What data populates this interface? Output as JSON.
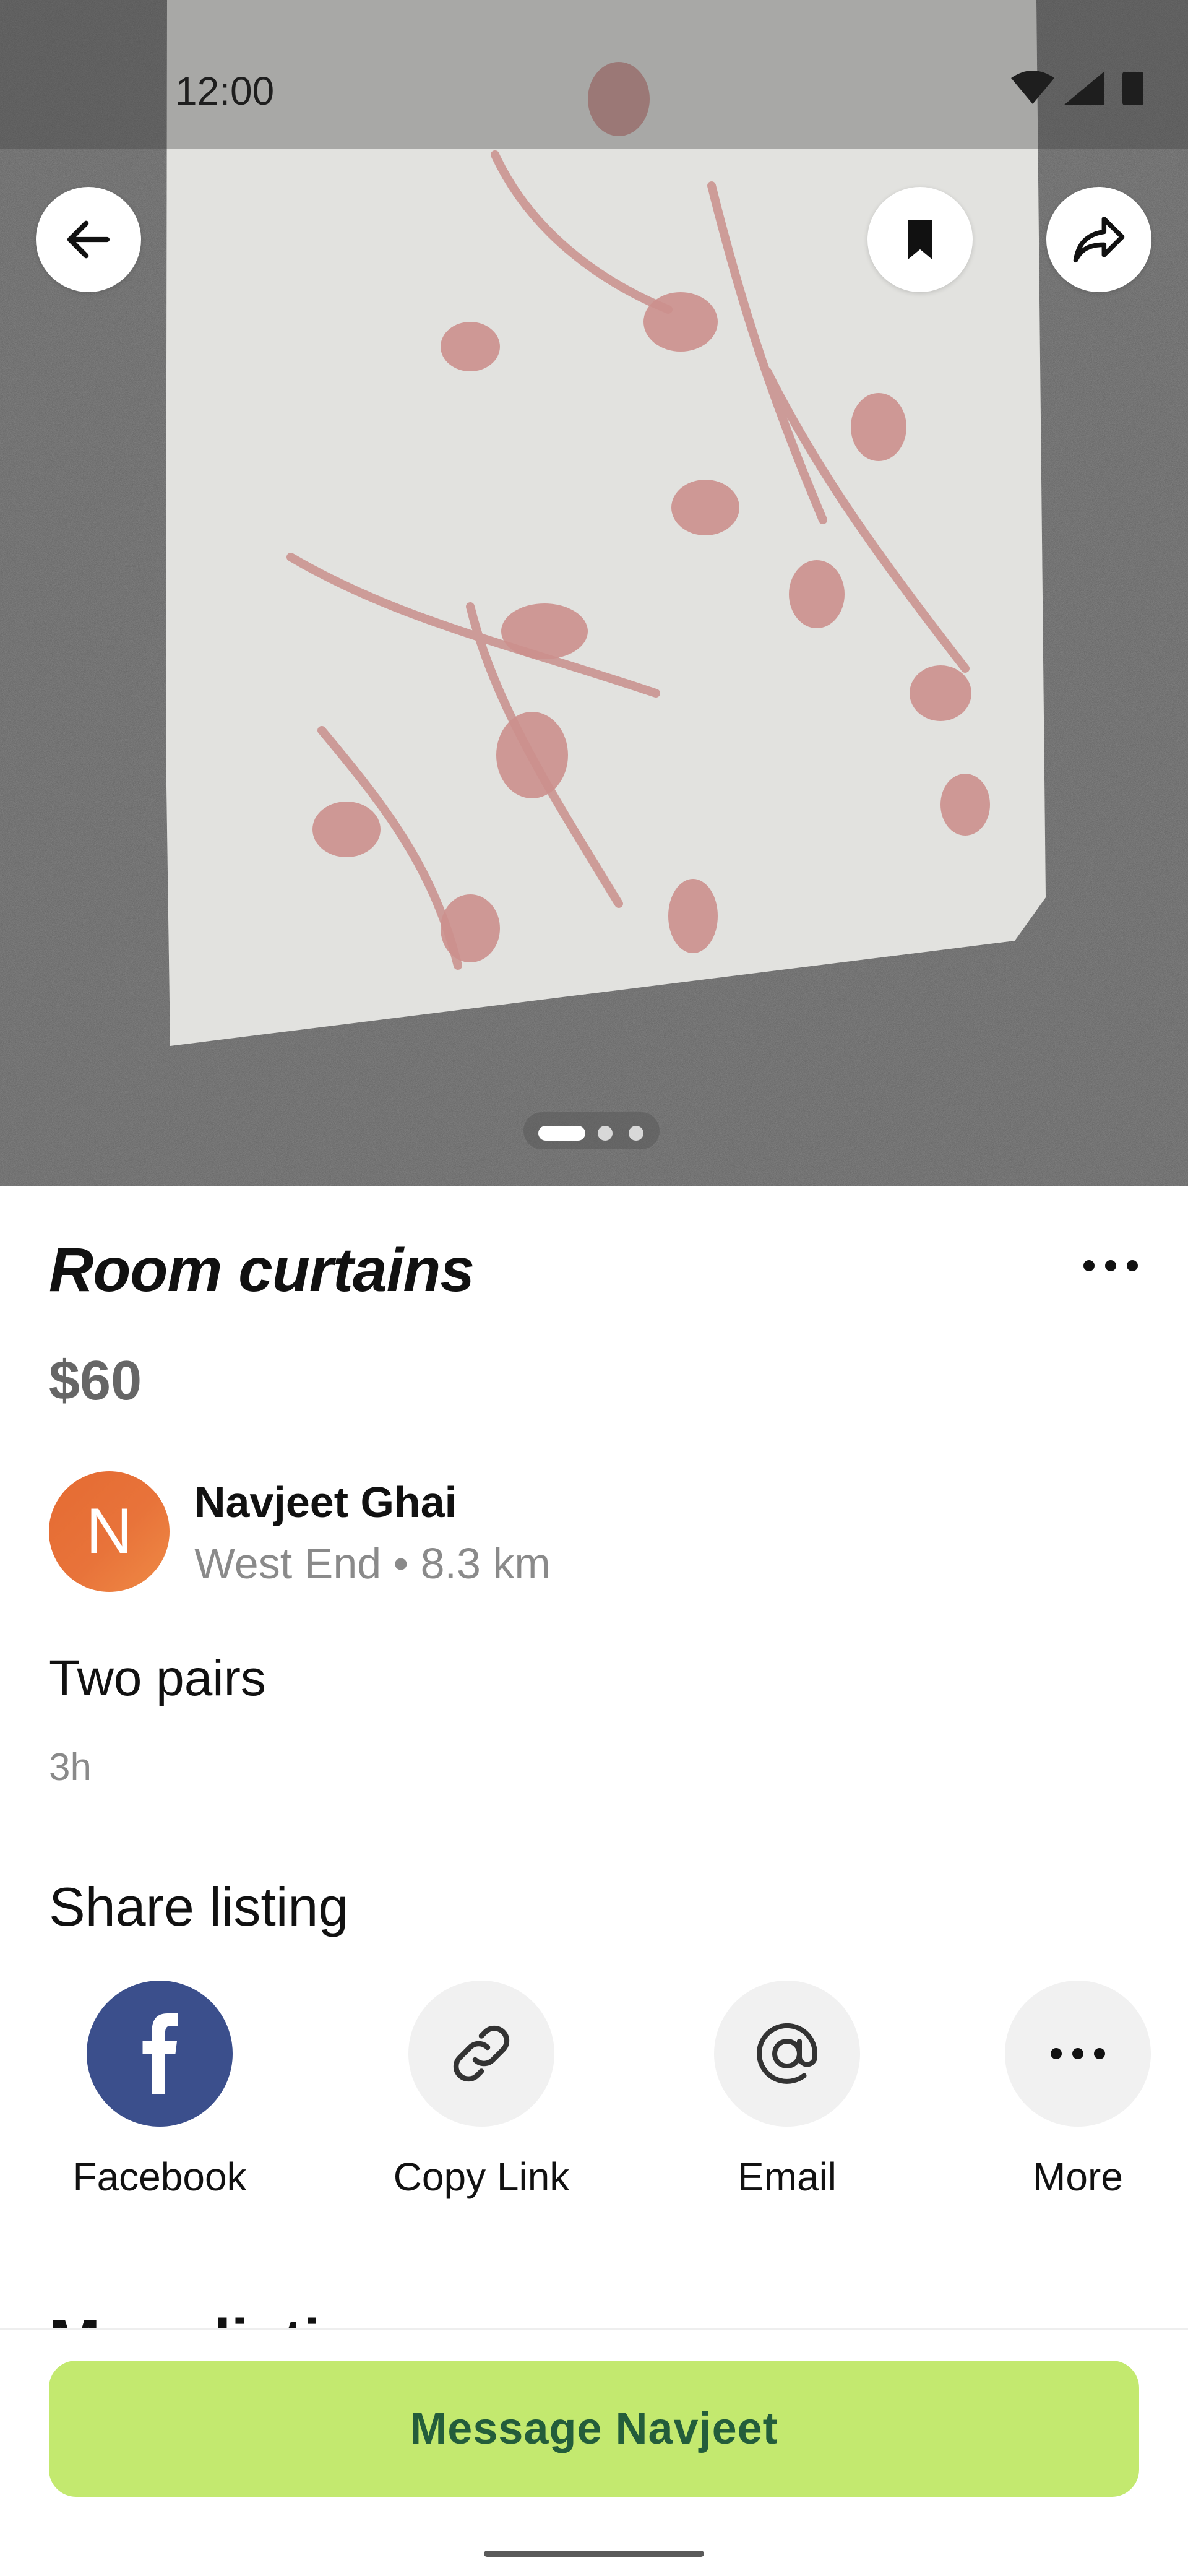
{
  "status_bar": {
    "time": "12:00"
  },
  "listing": {
    "title": "Room curtains",
    "price": "$60",
    "seller": {
      "initial": "N",
      "name": "Navjeet Ghai",
      "location": "West End • 8.3 km"
    },
    "description": "Two pairs",
    "posted": "3h",
    "photo_count": 3,
    "current_photo": 1
  },
  "icons": {
    "back": "arrow-left-icon",
    "save": "bookmark-icon",
    "share": "share-arrow-icon",
    "more": "more-horizontal-icon"
  },
  "share": {
    "heading": "Share listing",
    "items": [
      {
        "label": "Facebook",
        "icon": "facebook-icon",
        "color": "#3b4f8c"
      },
      {
        "label": "Copy Link",
        "icon": "link-icon"
      },
      {
        "label": "Email",
        "icon": "at-sign-icon"
      },
      {
        "label": "More",
        "icon": "more-horizontal-icon"
      }
    ]
  },
  "more_listings": {
    "heading": "More listings"
  },
  "cta": {
    "label": "Message Navjeet",
    "color": "#c3e96f",
    "text_color": "#235d3b"
  }
}
